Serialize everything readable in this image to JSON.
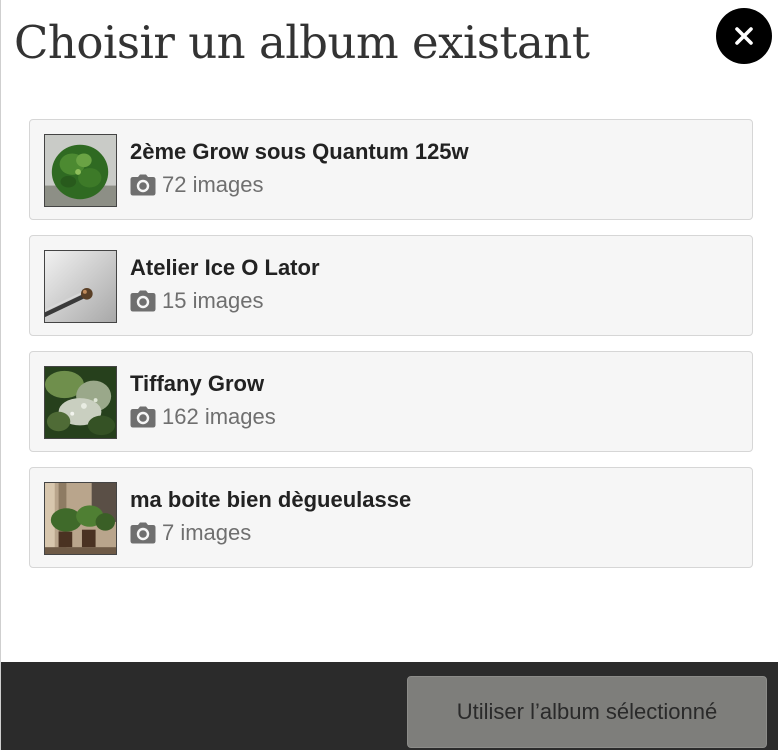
{
  "dialog": {
    "title": "Choisir un album existant",
    "close_icon": "close-icon"
  },
  "albums": [
    {
      "name": "2ème Grow sous Quantum 125w",
      "count": "72 images",
      "thumbnail": "cannabis-plant-photo"
    },
    {
      "name": "Atelier Ice O Lator",
      "count": "15 images",
      "thumbnail": "dab-tool-photo"
    },
    {
      "name": "Tiffany Grow",
      "count": "162 images",
      "thumbnail": "cannabis-bud-photo"
    },
    {
      "name": "ma boite bien dègueulasse",
      "count": "7 images",
      "thumbnail": "grow-box-photo"
    }
  ],
  "count_icon": "camera-icon",
  "footer": {
    "use_album_label": "Utiliser l’album sélectionné"
  },
  "colors": {
    "close_button_bg": "#000000",
    "footer_bg": "#2b2b2b",
    "button_bg": "#7e7e7b",
    "item_bg": "#f6f6f6"
  }
}
